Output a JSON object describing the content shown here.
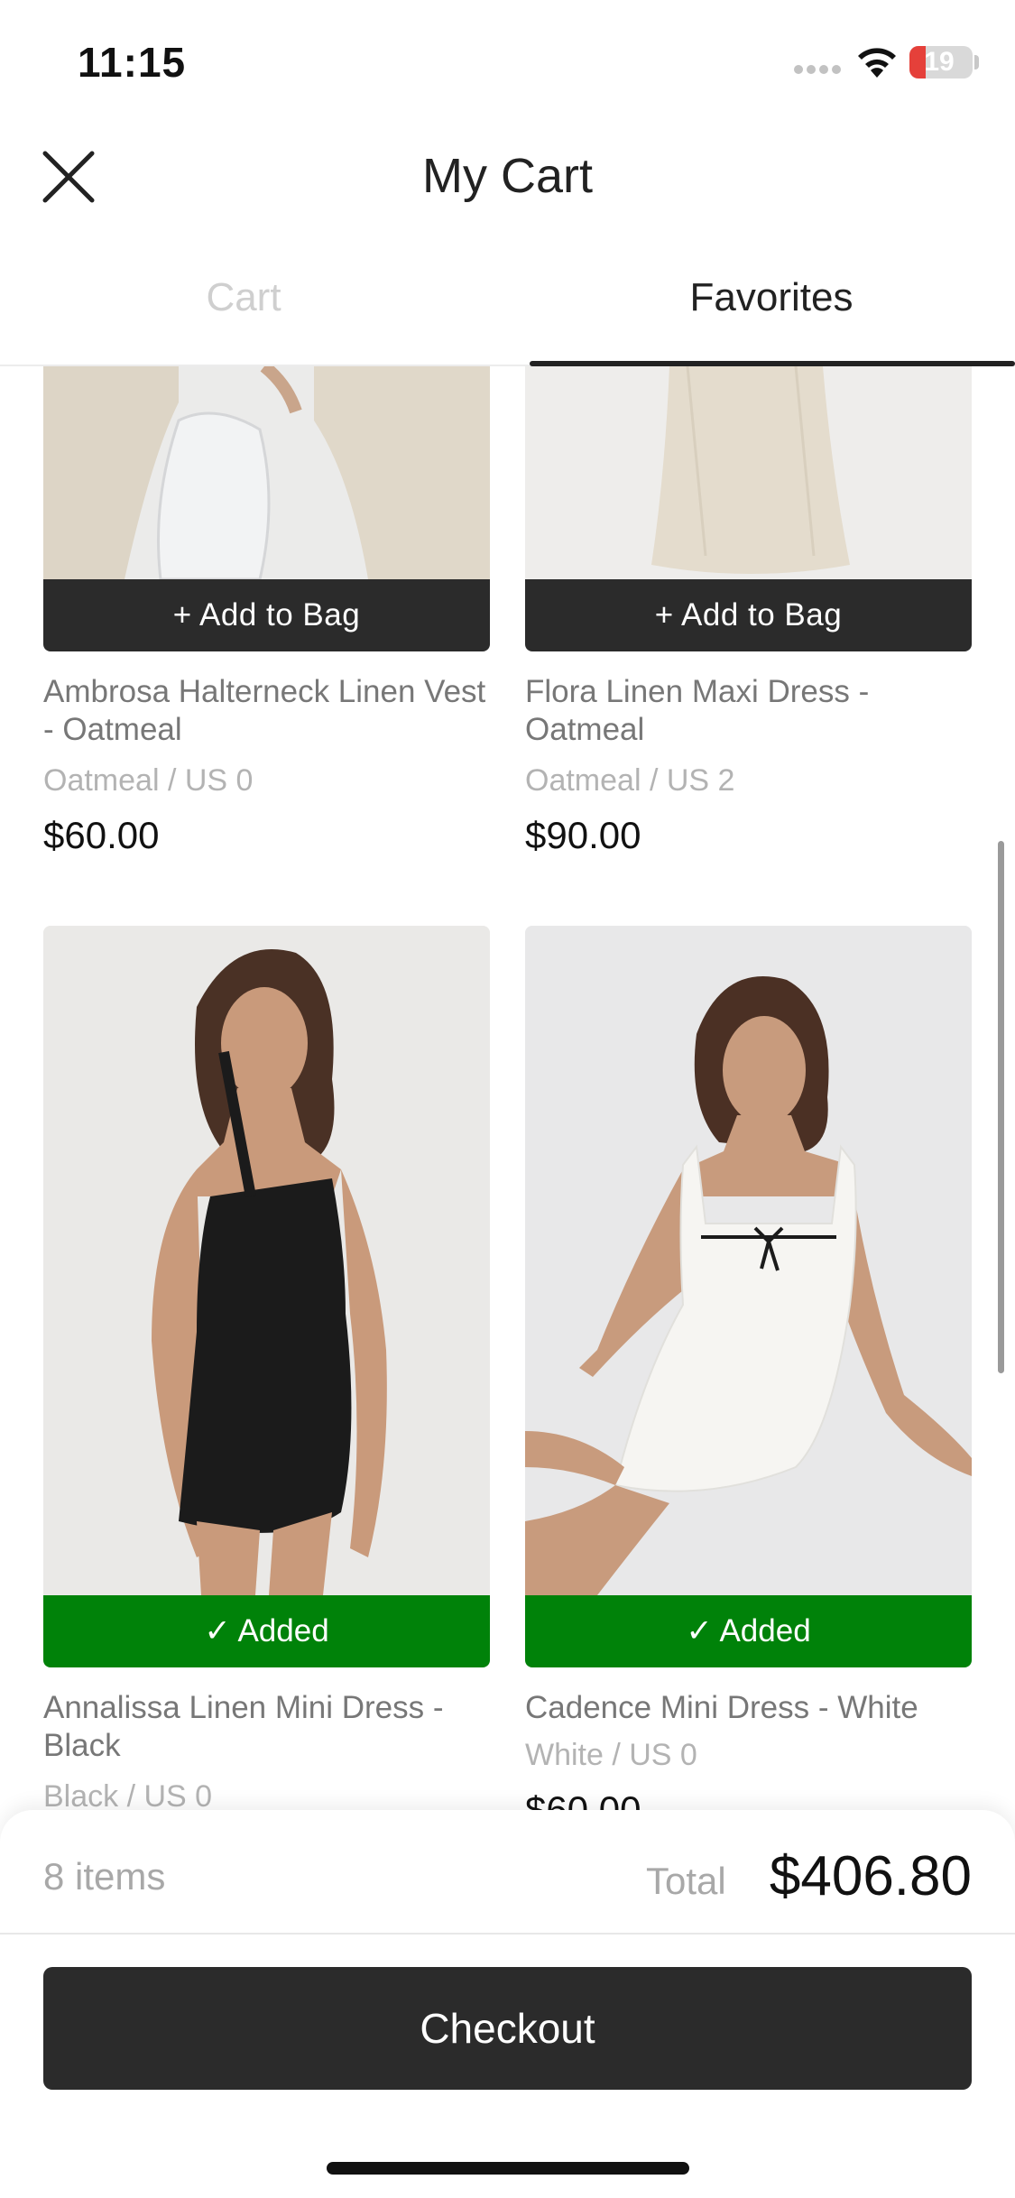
{
  "status_bar": {
    "time": "11:15",
    "battery": "19"
  },
  "header": {
    "title": "My Cart"
  },
  "tabs": [
    {
      "label": "Cart",
      "active": false
    },
    {
      "label": "Favorites",
      "active": true
    }
  ],
  "products": [
    {
      "name": "Ambrosa Halterneck Linen Vest - Oatmeal",
      "variant": "Oatmeal / US 0",
      "price": "$60.00",
      "action": "+ Add to Bag"
    },
    {
      "name": "Flora Linen Maxi Dress - Oatmeal",
      "variant": "Oatmeal / US 2",
      "price": "$90.00",
      "action": "+ Add to Bag"
    },
    {
      "name": "Annalissa Linen Mini Dress - Black",
      "variant": "Black / US 0",
      "price": "",
      "action": "✓ Added"
    },
    {
      "name": "Cadence Mini Dress - White",
      "variant": "White / US 0",
      "price": "$60.00",
      "action": "✓ Added"
    }
  ],
  "footer": {
    "items_count": "8 items",
    "total_label": "Total",
    "total_value": "$406.80",
    "checkout_label": "Checkout"
  },
  "colors": {
    "primary_dark": "#2b2b2b",
    "added_green": "#008209",
    "muted_text": "#a8a8a8"
  },
  "icons": {
    "close": "close-icon",
    "wifi": "wifi-icon",
    "battery": "battery-icon",
    "signal": "signal-icon"
  }
}
